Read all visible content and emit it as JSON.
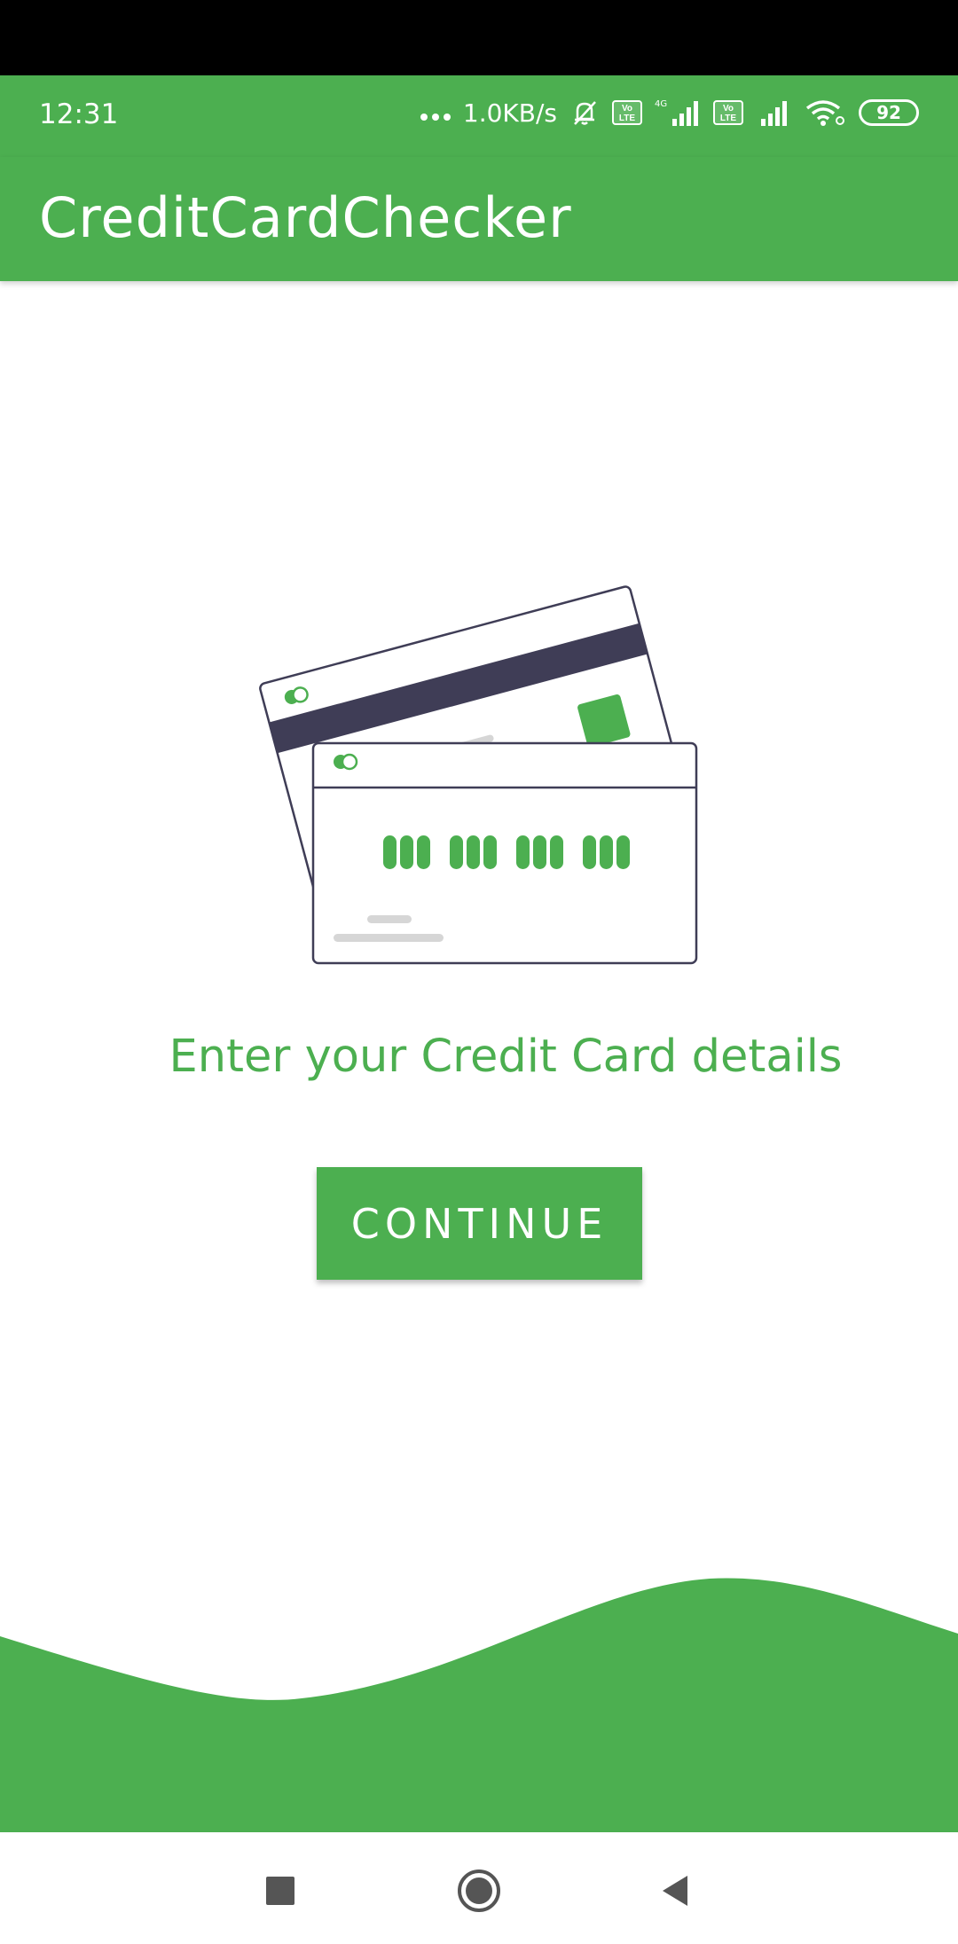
{
  "status_bar": {
    "time": "12:31",
    "net_speed": "1.0KB/s",
    "volte_label": "Vo LTE",
    "network_type": "4G",
    "battery": "92",
    "icons": [
      "more-dots-icon",
      "mute-bell-icon",
      "volte-icon",
      "signal-icon",
      "wifi-icon",
      "battery-icon"
    ]
  },
  "app_bar": {
    "title": "CreditCardChecker"
  },
  "main": {
    "prompt": "Enter your Credit Card details",
    "continue_label": "CONTINUE"
  },
  "nav_bar": {
    "icons": [
      "recents-square-icon",
      "home-circle-icon",
      "back-triangle-icon"
    ]
  },
  "colors": {
    "primary": "#4caf50",
    "card_stripe": "#3f3d56",
    "card_outline": "#3f3d56",
    "muted_lines": "#d6d6d6",
    "nav_icons": "#555555"
  }
}
